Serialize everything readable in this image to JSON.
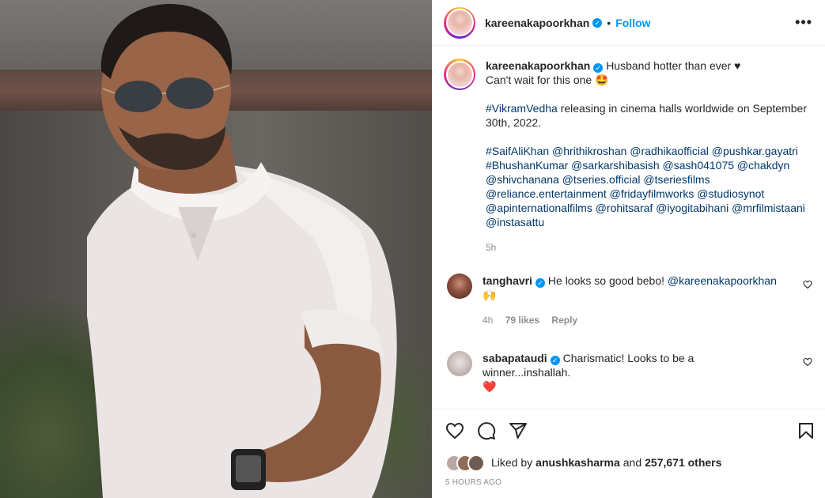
{
  "post": {
    "author": "kareenakapoorkhan",
    "follow_label": "Follow",
    "header_separator": "•",
    "more_icon": "more-options-icon",
    "verified_icon": "verified-badge-icon"
  },
  "caption": {
    "author": "kareenakapoorkhan",
    "line1": "Husband hotter than ever",
    "line1_suffix": "♥",
    "line2": "Can't wait for this one",
    "line2_suffix": "🤩",
    "hashtag1": "#VikramVedha",
    "line3a": " releasing in cinema halls worldwide on September",
    "line3b": "30th, 2022.",
    "tags": [
      "#SaifAliKhan @hrithikroshan @radhikaofficial @pushkar.gayatri",
      "#BhushanKumar @sarkarshibasish @sash041075 @chakdyn",
      "@shivchanana @tseries.official @tseriesfilms",
      "@reliance.entertainment @fridayfilmworks @studiosynot",
      "@apinternationalfilms @rohitsaraf @iyogitabihani @mrfilmistaani",
      "@instasattu"
    ],
    "time": "5h"
  },
  "comments": [
    {
      "user": "tanghavri",
      "text": "He looks so good bebo! ",
      "mention": "@kareenakapoorkhan",
      "line2": "🙌",
      "time": "4h",
      "likes": "79 likes",
      "reply": "Reply"
    },
    {
      "user": "sabapataudi",
      "text": "Charismatic! Looks to be a winner...inshallah.",
      "line2": "❤️"
    }
  ],
  "actions": {
    "like_icon": "heart-icon",
    "comment_icon": "comment-icon",
    "share_icon": "share-icon",
    "save_icon": "bookmark-icon"
  },
  "likes": {
    "prefix": "Liked by ",
    "user": "anushkasharma",
    "middle": " and ",
    "count": "257,671 others"
  },
  "posted_time": "5 HOURS AGO",
  "colors": {
    "link": "#0095f6",
    "mention": "#00376b",
    "muted": "#8e8e8e",
    "verified": "#0095f6"
  }
}
